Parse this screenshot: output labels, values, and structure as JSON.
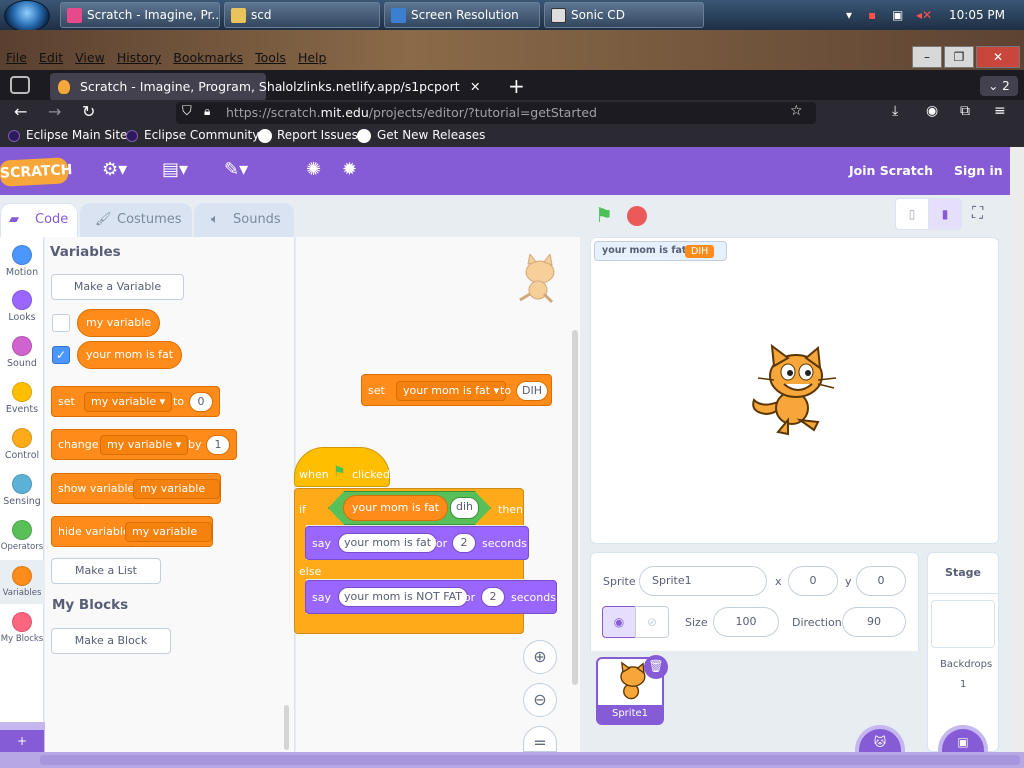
{
  "taskbar": {
    "buttons": [
      "Scratch - Imagine, Pr...",
      "scd",
      "Screen Resolution",
      "Sonic CD"
    ],
    "clock": "10:05 PM"
  },
  "browser": {
    "menu": [
      "File",
      "Edit",
      "View",
      "History",
      "Bookmarks",
      "Tools",
      "Help"
    ],
    "tabs": [
      "Scratch - Imagine, Program, Sha",
      "lolzlinks.netlify.app/s1pcport"
    ],
    "tab_count": "2",
    "url_prefix": "https://scratch.",
    "url_host": "mit.edu",
    "url_rest": "/projects/editor/?tutorial=getStarted",
    "bookmarks": [
      "Eclipse Main Site",
      "Eclipse Community",
      "Report Issues",
      "Get New Releases"
    ]
  },
  "scratch": {
    "logo": "SCRATCH",
    "join": "Join Scratch",
    "signin": "Sign in",
    "tabs": [
      "Code",
      "Costumes",
      "Sounds"
    ],
    "categories": [
      {
        "label": "Motion",
        "color": "#4c97ff"
      },
      {
        "label": "Looks",
        "color": "#9966ff"
      },
      {
        "label": "Sound",
        "color": "#cf63cf"
      },
      {
        "label": "Events",
        "color": "#ffbf00"
      },
      {
        "label": "Control",
        "color": "#ffab19"
      },
      {
        "label": "Sensing",
        "color": "#5cb1d6"
      },
      {
        "label": "Operators",
        "color": "#59c059"
      },
      {
        "label": "Variables",
        "color": "#ff8c1a"
      },
      {
        "label": "My Blocks",
        "color": "#ff6680"
      }
    ],
    "palette": {
      "title_vars": "Variables",
      "make_var": "Make a Variable",
      "var1": "my variable",
      "var2": "your mom is fat",
      "set": {
        "w1": "set",
        "var": "my variable",
        "w2": "to",
        "val": "0"
      },
      "change": {
        "w1": "change",
        "var": "my variable",
        "w2": "by",
        "val": "1"
      },
      "show": {
        "w1": "show variable",
        "var": "my variable"
      },
      "hide": {
        "w1": "hide variable",
        "var": "my variable"
      },
      "make_list": "Make a List",
      "title_blocks": "My Blocks",
      "make_block": "Make a Block"
    },
    "script": {
      "set": {
        "w1": "set",
        "var": "your mom is fat",
        "w2": "to",
        "val": "DIH"
      },
      "when": "when",
      "clicked": "clicked",
      "if": "if",
      "then": "then",
      "cond_var": "your mom is fat",
      "eq": "=",
      "cond_val": "dih",
      "say1": {
        "w1": "say",
        "msg": "your mom is fat",
        "w2": "for",
        "secs": "2",
        "w3": "seconds"
      },
      "else": "else",
      "say2": {
        "w1": "say",
        "msg": "your mom is NOT FAT",
        "w2": "for",
        "secs": "2",
        "w3": "seconds"
      }
    },
    "monitor": {
      "label": "your mom is fat",
      "value": "DIH"
    },
    "sprite": {
      "label": "Sprite",
      "name": "Sprite1",
      "x_label": "x",
      "x": "0",
      "y_label": "y",
      "y": "0",
      "size_label": "Size",
      "size": "100",
      "dir_label": "Direction",
      "dir": "90",
      "thumb_name": "Sprite1"
    },
    "stage": {
      "title": "Stage",
      "backdrops_label": "Backdrops",
      "backdrops": "1"
    }
  }
}
